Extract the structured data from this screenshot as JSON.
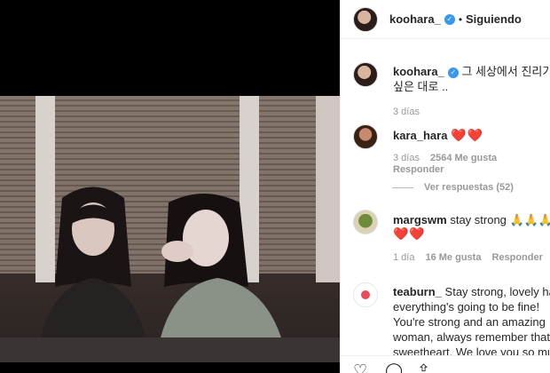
{
  "post": {
    "username": "koohara_",
    "follow_label": "Siguiendo",
    "dot": "•"
  },
  "caption": {
    "username": "koohara_",
    "text_line1": "그 세상에서 진리가",
    "text_line2": "싶은 대로 ..",
    "time": "3 días"
  },
  "comments": [
    {
      "username": "kara_hara",
      "text": "❤️❤️",
      "time": "3 días",
      "likes": "2564 Me gusta",
      "reply": "Responder",
      "view_replies": "Ver respuestas (52)"
    },
    {
      "username": "margswm",
      "text": "stay strong 🙏🙏🙏",
      "text2": "❤️❤️",
      "time": "1 día",
      "likes": "16 Me gusta",
      "reply": "Responder"
    },
    {
      "username": "teaburn_",
      "line1": "Stay strong, lovely hara",
      "line2": "everything's going to be fine!",
      "line3": "You're strong and an amazing",
      "line4": "woman, always remember that,",
      "line5": "sweetheart. We love you so much"
    }
  ],
  "icons": {
    "verified": "verified-badge-icon",
    "like": "heart-outline-icon",
    "comment": "comment-bubble-icon",
    "share": "share-icon"
  },
  "colors": {
    "accent": "#3897f0",
    "heart": "#ed4956",
    "meta": "#999999"
  }
}
